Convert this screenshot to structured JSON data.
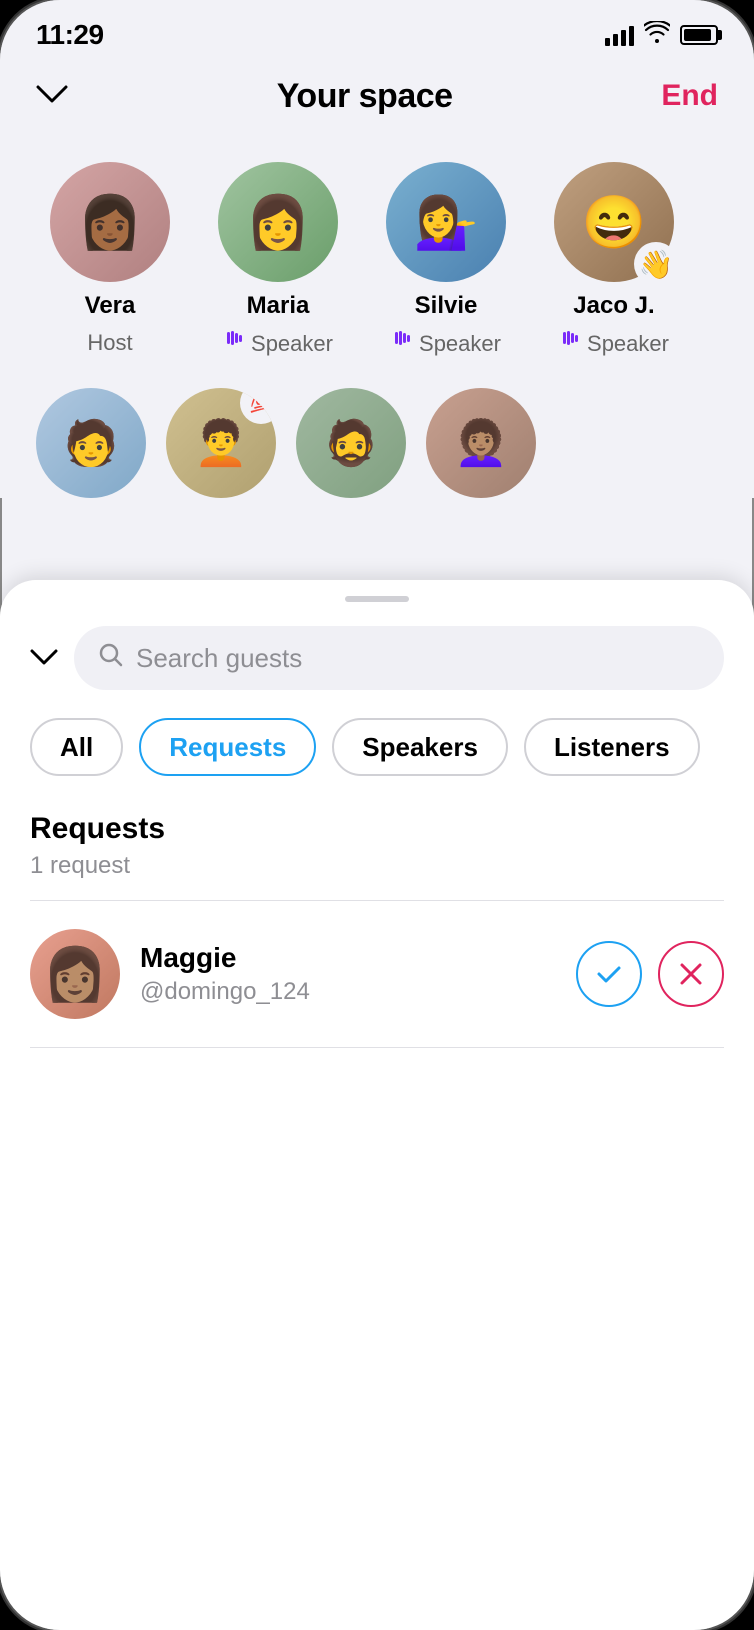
{
  "status_bar": {
    "time": "11:29",
    "signal_bars": [
      8,
      12,
      16,
      20
    ],
    "wifi": "wifi",
    "battery": 90
  },
  "header": {
    "chevron_label": "chevron down",
    "title": "Your space",
    "end_label": "End"
  },
  "speakers": [
    {
      "name": "Vera",
      "role": "Host",
      "has_mic": false,
      "has_wave": false,
      "avatar_class": "avatar-vera"
    },
    {
      "name": "Maria",
      "role": "Speaker",
      "has_mic": true,
      "has_wave": false,
      "avatar_class": "avatar-maria"
    },
    {
      "name": "Silvie",
      "role": "Speaker",
      "has_mic": true,
      "has_wave": false,
      "avatar_class": "avatar-silvie"
    },
    {
      "name": "Jaco J.",
      "role": "Speaker",
      "has_mic": true,
      "has_wave": true,
      "avatar_class": "avatar-jaco"
    }
  ],
  "listeners": [
    {
      "id": "a",
      "avatar_class": "listener-a",
      "has_badge": false
    },
    {
      "id": "b",
      "avatar_class": "listener-b",
      "has_badge": true,
      "badge": "💯"
    },
    {
      "id": "c",
      "avatar_class": "listener-c",
      "has_badge": false
    },
    {
      "id": "d",
      "avatar_class": "listener-d",
      "has_badge": false
    }
  ],
  "sheet": {
    "search_placeholder": "Search guests",
    "tabs": [
      {
        "id": "all",
        "label": "All",
        "active": false
      },
      {
        "id": "requests",
        "label": "Requests",
        "active": true
      },
      {
        "id": "speakers",
        "label": "Speakers",
        "active": false
      },
      {
        "id": "listeners",
        "label": "Listeners",
        "active": false
      }
    ],
    "requests_section": {
      "title": "Requests",
      "count_label": "1 request",
      "items": [
        {
          "name": "Maggie",
          "handle": "@domingo_124",
          "avatar_class": "request-avatar"
        }
      ]
    }
  },
  "icons": {
    "mic_symbol": "▌▌▌",
    "checkmark": "✓",
    "cross": "✕",
    "wave": "👋",
    "hundred": "💯"
  }
}
